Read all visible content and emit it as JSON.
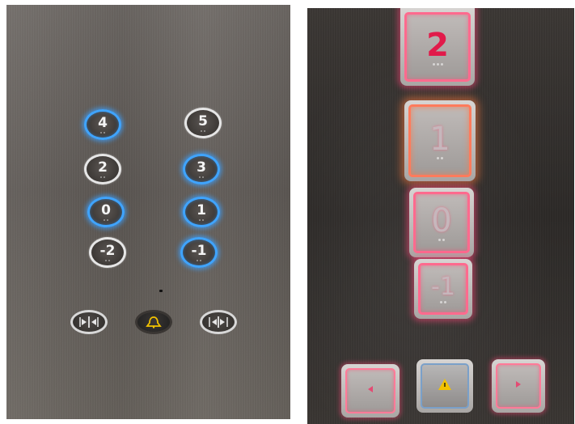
{
  "left_panel": {
    "floor_buttons": [
      {
        "label": "4",
        "lit": true
      },
      {
        "label": "5",
        "lit": false
      },
      {
        "label": "2",
        "lit": false
      },
      {
        "label": "3",
        "lit": true
      },
      {
        "label": "0",
        "lit": true
      },
      {
        "label": "1",
        "lit": true
      },
      {
        "label": "-2",
        "lit": false
      },
      {
        "label": "-1",
        "lit": true
      }
    ],
    "function_buttons": [
      {
        "icon": "door-open-icon",
        "color": "#e6e6e6"
      },
      {
        "icon": "alarm-bell-icon",
        "color": "#f2c200"
      },
      {
        "icon": "door-close-icon",
        "color": "#e6e6e6"
      }
    ],
    "lit_color": "#3fa4ff"
  },
  "right_panel": {
    "floor_buttons": [
      {
        "label": "2",
        "style": "red-digit"
      },
      {
        "label": "1",
        "style": "orange-glow"
      },
      {
        "label": "0",
        "style": "pink-glow"
      },
      {
        "label": "-1",
        "style": "pink-glow"
      }
    ],
    "function_buttons": [
      {
        "icon": "door-open-icon"
      },
      {
        "icon": "alarm-bell-icon",
        "color": "#f2c200"
      },
      {
        "icon": "door-close-icon"
      }
    ],
    "glow_color": "#ff6a8e"
  }
}
